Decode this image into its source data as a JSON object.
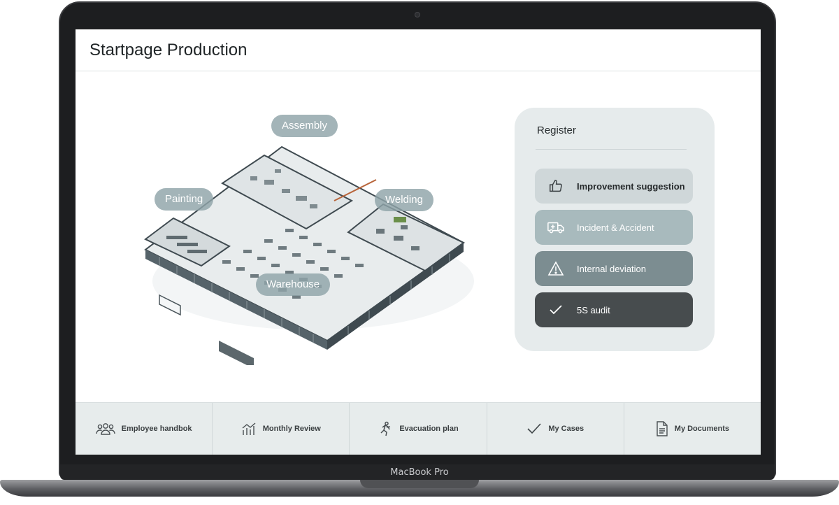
{
  "device": {
    "model_label": "MacBook Pro"
  },
  "header": {
    "title": "Startpage Production"
  },
  "floor_plan": {
    "areas": [
      {
        "label": "Assembly"
      },
      {
        "label": "Painting"
      },
      {
        "label": "Welding"
      },
      {
        "label": "Warehouse"
      }
    ]
  },
  "register": {
    "title": "Register",
    "buttons": [
      {
        "label": "Improvement suggestion",
        "icon": "thumbs-up-icon"
      },
      {
        "label": "Incident & Accident",
        "icon": "ambulance-icon"
      },
      {
        "label": "Internal deviation",
        "icon": "warning-icon"
      },
      {
        "label": "5S audit",
        "icon": "check-icon"
      }
    ]
  },
  "bottom_nav": [
    {
      "label": "Employee handbok",
      "icon": "people-icon"
    },
    {
      "label": "Monthly Review",
      "icon": "chart-icon"
    },
    {
      "label": "Evacuation plan",
      "icon": "running-person-icon"
    },
    {
      "label": "My Cases",
      "icon": "check-icon"
    },
    {
      "label": "My Documents",
      "icon": "document-icon"
    }
  ],
  "colors": {
    "register_bg": "#e6ebec",
    "button_improvement": "#cfd7d9",
    "button_incident": "#a8babd",
    "button_deviation": "#7c8d91",
    "button_audit": "#474c4e",
    "area_tag": "#8fa3a8"
  }
}
